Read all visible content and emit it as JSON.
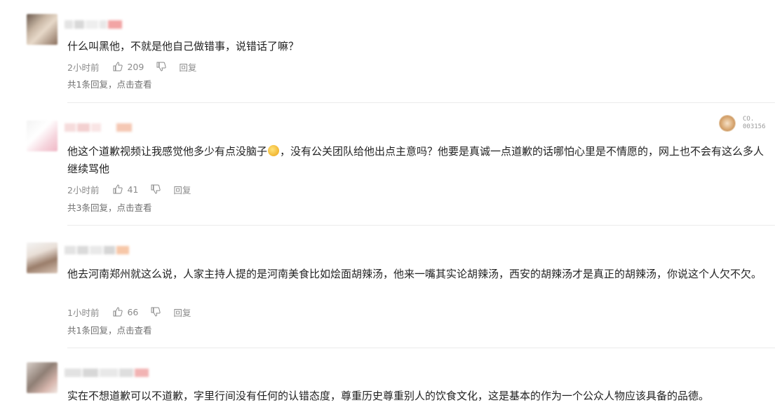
{
  "comments": [
    {
      "text": "什么叫黑他，不就是他自己做错事，说错话了嘛？",
      "time": "2小时前",
      "likes": "209",
      "reply_label": "回复",
      "replies_text": "共1条回复，点击查看"
    },
    {
      "text_before_emoji": "他这个道歉视频让我感觉他多少有点没脑子",
      "text_after_emoji": "，没有公关团队给他出点主意吗？他要是真诚一点道歉的话哪怕心里是不情愿的，网上也不会有这么多人继续骂他",
      "time": "2小时前",
      "likes": "41",
      "reply_label": "回复",
      "replies_text": "共3条回复，点击查看"
    },
    {
      "text": "他去河南郑州就这么说，人家主持人提的是河南美食比如烩面胡辣汤，他来一嘴其实论胡辣汤，西安的胡辣汤才是真正的胡辣汤，你说这个人欠不欠。",
      "time": "1小时前",
      "likes": "66",
      "reply_label": "回复",
      "replies_text": "共1条回复，点击查看"
    },
    {
      "text": "实在不想道歉可以不道歉，字里行间没有任何的认错态度，尊重历史尊重别人的饮食文化，这是基本的作为一个公众人物应该具备的品德。"
    }
  ],
  "watermark": {
    "line1": "CO.",
    "line2": "003156"
  },
  "icons": {
    "like": "thumbs-up-icon",
    "dislike": "thumbs-down-icon"
  }
}
